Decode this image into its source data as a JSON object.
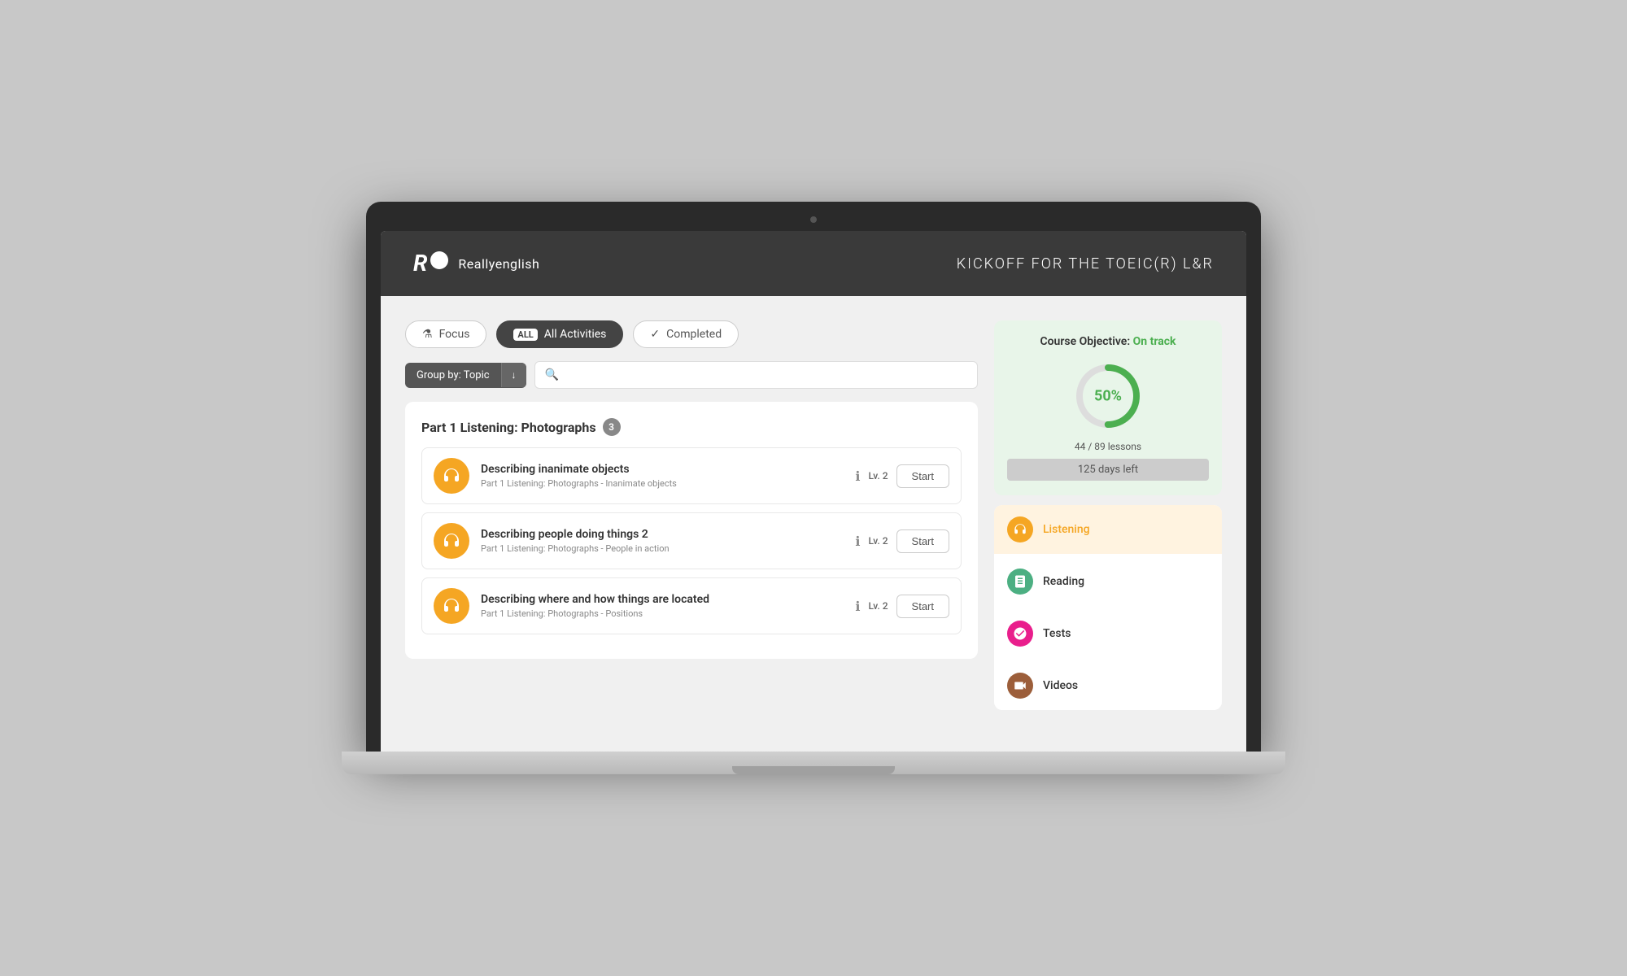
{
  "header": {
    "logo_letter": "R",
    "logo_name": "Reallyenglish",
    "course_title": "KICKOFF FOR THE TOEIC(R) L&R"
  },
  "filters": {
    "focus_label": "Focus",
    "all_activities_label": "All Activities",
    "all_badge": "ALL",
    "completed_label": "Completed"
  },
  "group_by": {
    "label": "Group by:  Topic",
    "arrow": "↓",
    "search_placeholder": ""
  },
  "section": {
    "title": "Part 1 Listening: Photographs",
    "badge": "3"
  },
  "activities": [
    {
      "title": "Describing inanimate objects",
      "subtitle": "Part 1 Listening: Photographs - Inanimate objects",
      "level": "Lv. 2",
      "btn_label": "Start"
    },
    {
      "title": "Describing people doing things 2",
      "subtitle": "Part 1 Listening: Photographs - People in action",
      "level": "Lv. 2",
      "btn_label": "Start"
    },
    {
      "title": "Describing where and how things are located",
      "subtitle": "Part 1 Listening: Photographs - Positions",
      "level": "Lv. 2",
      "btn_label": "Start"
    }
  ],
  "objective": {
    "title": "Course Objective:",
    "status": "On track",
    "percent": "50%",
    "lessons_done": "44",
    "lessons_total": "89",
    "lessons_label": "lessons",
    "days_left": "125 days left",
    "progress_value": 50
  },
  "categories": [
    {
      "key": "listening",
      "label": "Listening",
      "active": true
    },
    {
      "key": "reading",
      "label": "Reading",
      "active": false
    },
    {
      "key": "tests",
      "label": "Tests",
      "active": false
    },
    {
      "key": "videos",
      "label": "Videos",
      "active": false
    }
  ]
}
